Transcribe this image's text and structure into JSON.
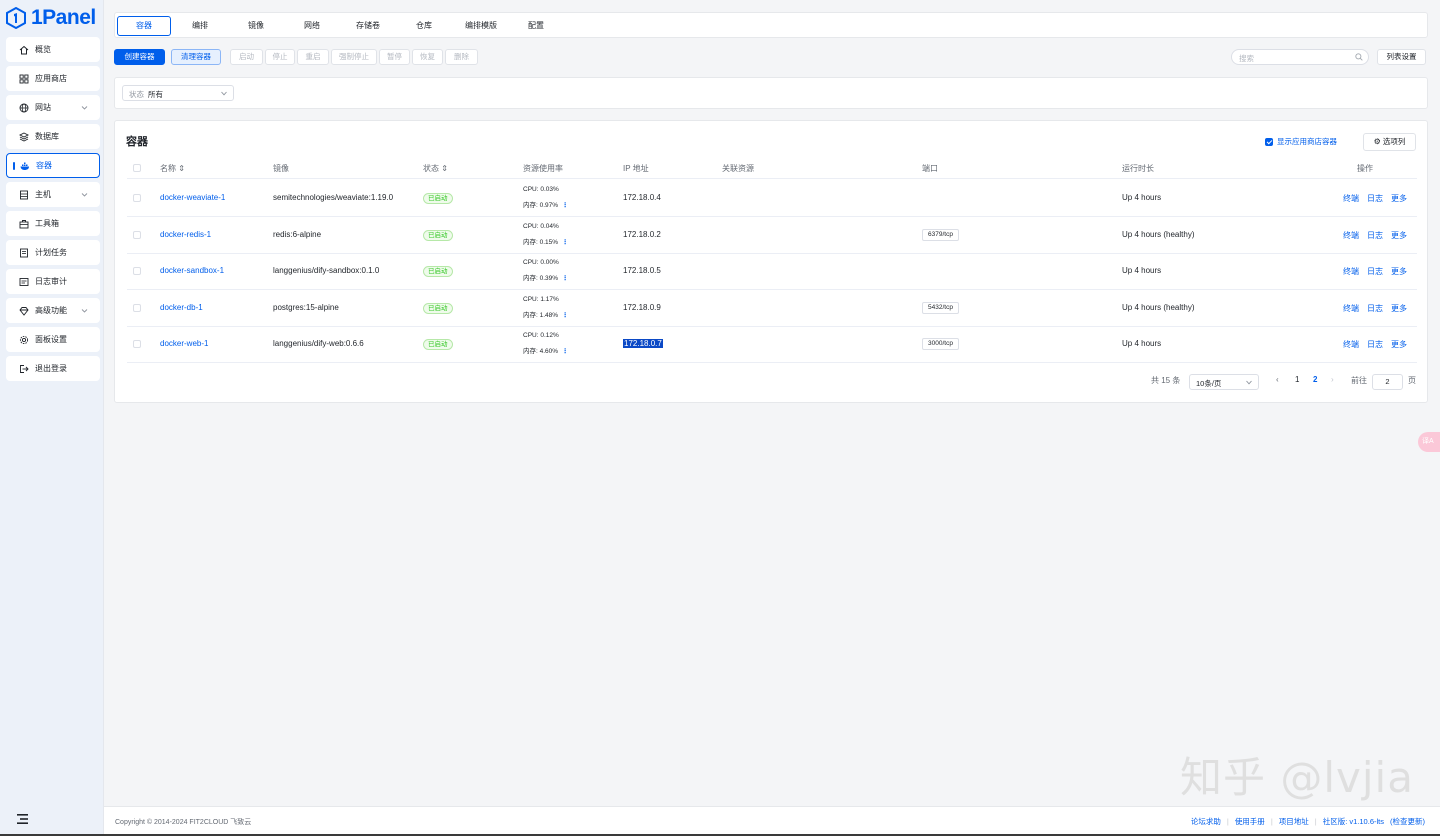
{
  "brand": {
    "name": "1Panel",
    "accent": "#005eeb"
  },
  "sidebar": {
    "items": [
      {
        "label": "概览",
        "icon": "home-icon",
        "active": false
      },
      {
        "label": "应用商店",
        "icon": "grid-icon",
        "active": false
      },
      {
        "label": "网站",
        "icon": "globe-icon",
        "active": false,
        "has_submenu": true
      },
      {
        "label": "数据库",
        "icon": "layers-icon",
        "active": false
      },
      {
        "label": "容器",
        "icon": "docker-icon",
        "active": true
      },
      {
        "label": "主机",
        "icon": "server-icon",
        "active": false,
        "has_submenu": true
      },
      {
        "label": "工具箱",
        "icon": "toolbox-icon",
        "active": false
      },
      {
        "label": "计划任务",
        "icon": "list-icon",
        "active": false
      },
      {
        "label": "日志审计",
        "icon": "log-icon",
        "active": false
      },
      {
        "label": "高级功能",
        "icon": "diamond-icon",
        "active": false,
        "has_submenu": true
      },
      {
        "label": "面板设置",
        "icon": "gear-icon",
        "active": false
      },
      {
        "label": "退出登录",
        "icon": "logout-icon",
        "active": false
      }
    ]
  },
  "tabs": [
    "容器",
    "编排",
    "镜像",
    "网络",
    "存储卷",
    "仓库",
    "编排模版",
    "配置"
  ],
  "active_tab": "容器",
  "toolbar": {
    "create": "创建容器",
    "clean": "清理容器",
    "actions": [
      "启动",
      "停止",
      "重启",
      "强制停止",
      "暂停",
      "恢复",
      "删除"
    ],
    "search_placeholder": "搜索",
    "list_settings": "列表设置"
  },
  "filter": {
    "label": "状态",
    "value": "所有"
  },
  "table": {
    "title": "容器",
    "show_app_containers": "显示应用商店容器",
    "show_app_containers_checked": true,
    "column_options": "选项列",
    "columns": [
      "名称",
      "镜像",
      "状态",
      "资源使用率",
      "IP 地址",
      "关联资源",
      "端口",
      "运行时长",
      "操作"
    ],
    "rows": [
      {
        "name": "docker-weaviate-1",
        "image": "semitechnologies/weaviate:1.19.0",
        "status": "已启动",
        "cpu": "CPU: 0.03%",
        "mem": "内存: 0.97%",
        "ip": "172.18.0.4",
        "port": "",
        "uptime": "Up 4 hours"
      },
      {
        "name": "docker-redis-1",
        "image": "redis:6-alpine",
        "status": "已启动",
        "cpu": "CPU: 0.04%",
        "mem": "内存: 0.15%",
        "ip": "172.18.0.2",
        "port": "6379/tcp",
        "uptime": "Up 4 hours (healthy)"
      },
      {
        "name": "docker-sandbox-1",
        "image": "langgenius/dify-sandbox:0.1.0",
        "status": "已启动",
        "cpu": "CPU: 0.00%",
        "mem": "内存: 0.39%",
        "ip": "172.18.0.5",
        "port": "",
        "uptime": "Up 4 hours"
      },
      {
        "name": "docker-db-1",
        "image": "postgres:15-alpine",
        "status": "已启动",
        "cpu": "CPU: 1.17%",
        "mem": "内存: 1.48%",
        "ip": "172.18.0.9",
        "port": "5432/tcp",
        "uptime": "Up 4 hours (healthy)"
      },
      {
        "name": "docker-web-1",
        "image": "langgenius/dify-web:0.6.6",
        "status": "已启动",
        "cpu": "CPU: 0.12%",
        "mem": "内存: 4.60%",
        "ip": "172.18.0.7",
        "port": "3000/tcp",
        "uptime": "Up 4 hours"
      }
    ],
    "row_ops": [
      "终端",
      "日志",
      "更多"
    ]
  },
  "pagination": {
    "total": "共 15 条",
    "page_size": "10条/页",
    "pages": [
      "1",
      "2"
    ],
    "current": "2",
    "goto_label": "前往",
    "goto_value": "2",
    "page_unit": "页"
  },
  "footer": {
    "copyright": "Copyright © 2014-2024 FIT2CLOUD 飞致云",
    "links": [
      "论坛求助",
      "使用手册",
      "项目地址"
    ],
    "version": "社区版: v1.10.6-lts",
    "check_update": "(检查更新)"
  },
  "float_button": "译A",
  "watermark": "知乎 @lvjia"
}
